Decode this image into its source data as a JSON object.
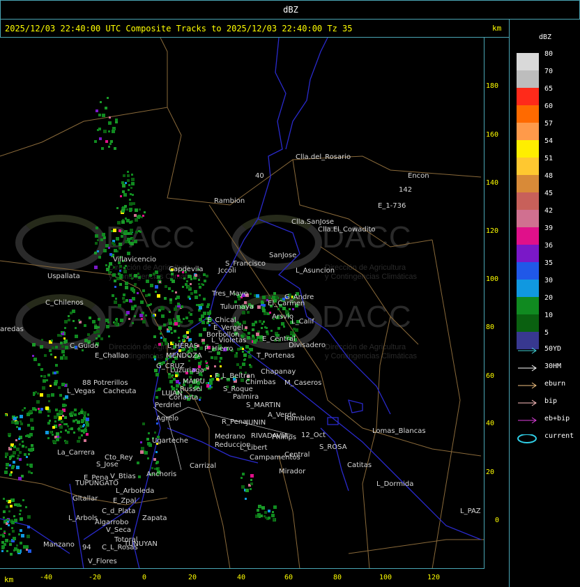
{
  "top_title": "dBZ",
  "header": {
    "text": "2025/12/03 22:40:00 UTC Composite Tracks to 2025/12/03 22:40:00 Tz 35"
  },
  "units": {
    "km_top": "km",
    "km_bottom": "km"
  },
  "legend": {
    "title": "dBZ",
    "levels": [
      {
        "label": "80",
        "color": "#d9d9d9"
      },
      {
        "label": "70",
        "color": "#bdbdbd"
      },
      {
        "label": "65",
        "color": "#ff2a1a"
      },
      {
        "label": "60",
        "color": "#ff6a00"
      },
      {
        "label": "57",
        "color": "#ff9a4a"
      },
      {
        "label": "54",
        "color": "#ffee00"
      },
      {
        "label": "51",
        "color": "#ffc830"
      },
      {
        "label": "48",
        "color": "#d88a38"
      },
      {
        "label": "45",
        "color": "#c8605a"
      },
      {
        "label": "42",
        "color": "#d07090"
      },
      {
        "label": "39",
        "color": "#e0108a"
      },
      {
        "label": "36",
        "color": "#7a18c8"
      },
      {
        "label": "35",
        "color": "#2058e8"
      },
      {
        "label": "30",
        "color": "#1098e0"
      },
      {
        "label": "20",
        "color": "#108a20"
      },
      {
        "label": "10",
        "color": "#0a6010"
      },
      {
        "label": "5",
        "color": "#383890"
      }
    ],
    "tracks": [
      {
        "label": "50YD",
        "color": "#40d0d8"
      },
      {
        "label": "30HM",
        "color": "#ffffff"
      },
      {
        "label": "eburn",
        "color": "#f0c080"
      },
      {
        "label": "bip",
        "color": "#ffc0c0"
      },
      {
        "label": "eb+bip",
        "color": "#e040e0"
      },
      {
        "label": "current",
        "color": "#30d0e8"
      }
    ]
  },
  "axes": {
    "y_ticks": [
      "180",
      "160",
      "140",
      "120",
      "100",
      "80",
      "60",
      "40",
      "20",
      "0"
    ],
    "x_ticks": [
      "-40",
      "-20",
      "0",
      "20",
      "40",
      "60",
      "80",
      "100",
      "120"
    ]
  },
  "watermark": {
    "brand": "DACC",
    "sub_line1": "Dirección de Agricultura",
    "sub_line2": "y Contingencias Climáticas"
  },
  "places": [
    "Clla.del_Rosario",
    "Encon",
    "142",
    "E_1-736",
    "Rambion",
    "40",
    "Clla.SanJose",
    "Clla.El_Cowadito",
    "Villavicencio",
    "Capdevila",
    "S_Francisco",
    "Jccoli",
    "SanJose",
    "L_Asuncion",
    "Uspallata",
    "Tres_Mayo",
    "Tulumaya",
    "G_Andre",
    "El_Carmen",
    "C_Chilenos",
    "E_Chical",
    "E_Vergel",
    "Arsvio",
    "L_Calif",
    "aredas",
    "Borbollon",
    "L_Violetas",
    "E_Central",
    "Divisadero",
    "C_Guido",
    "L_HERAS",
    "P_Hierro",
    "E_Challao",
    "MENDOZA",
    "T_Portenas",
    "G_CRUZ",
    "Luzuriaga",
    "Chapanay",
    "F_L_Beltran",
    "88",
    "Potrerillos",
    "MAIPU",
    "Russel",
    "Chimbas",
    "M_Caseros",
    "L_Vegas",
    "Cacheuta",
    "LUJAN",
    "Corlanta",
    "S_Roque",
    "Palmira",
    "Perdriel",
    "S_MARTIN",
    "A_Verde",
    "Agrelo",
    "R_Pena",
    "JUNIN",
    "Ramblon",
    "12_Oct",
    "Lomas_Blancas",
    "Ugarteche",
    "Medrano",
    "RIVADAVIA",
    "Phillips",
    "Reduccion",
    "L_Libert",
    "S_ROSA",
    "La_Carrera",
    "Cto_Rey",
    "S_Jose",
    "Campamentos",
    "Central",
    "Catitas",
    "Carrizal",
    "E_Pena",
    "V_Btias",
    "Anchoris",
    "TUPUNGATO",
    "Mirador",
    "L_Dormida",
    "L_Arboleda",
    "Gltallar",
    "E_Zpal",
    "C_d_Plata",
    "L_Arbols",
    "Zapata",
    "L_PAZ",
    "Algarrobo",
    "V_Seca",
    "Totoral",
    "TUNUYAN",
    "Manzano",
    "94",
    "C_L_Rosas",
    "V_Flores"
  ]
}
